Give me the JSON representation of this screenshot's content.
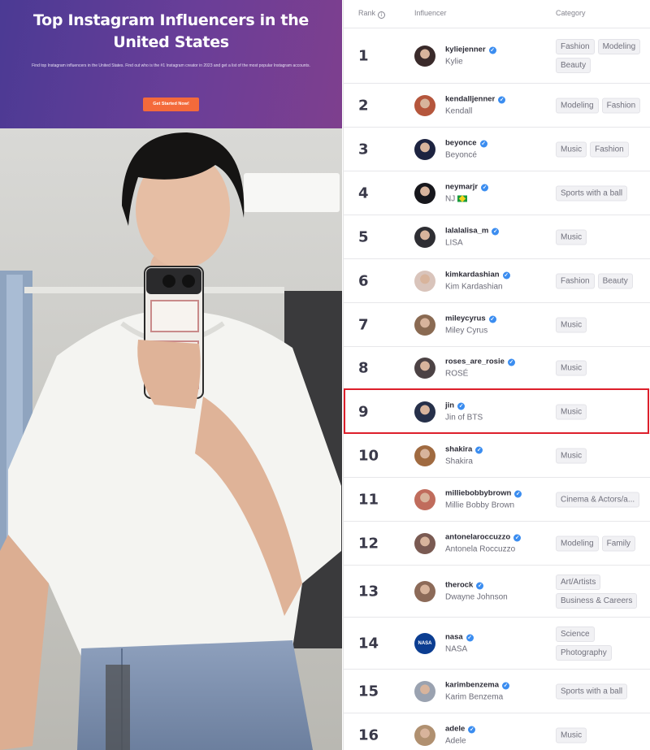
{
  "hero": {
    "title": "Top Instagram Influencers in the United States",
    "subtitle": "Find top Instagram influencers in the United States. Find out who is the #1 Instagram creator in 2023 and get a list of the most popular Instagram accounts.",
    "cta_label": "Get Started Now!"
  },
  "table": {
    "headers": {
      "rank": "Rank",
      "rank_info_icon": "info-icon",
      "influencer": "Influencer",
      "category": "Category"
    },
    "highlight_color": "#dd1f2b",
    "verified_color": "#3b8df0",
    "rows": [
      {
        "rank": "1",
        "handle": "kyliejenner",
        "name": "Kylie",
        "categories": [
          "Fashion",
          "Modeling",
          "Beauty"
        ],
        "avatar_color": "#3a2a2a"
      },
      {
        "rank": "2",
        "handle": "kendalljenner",
        "name": "Kendall",
        "categories": [
          "Modeling",
          "Fashion"
        ],
        "avatar_color": "#b5563c"
      },
      {
        "rank": "3",
        "handle": "beyonce",
        "name": "Beyoncé",
        "categories": [
          "Music",
          "Fashion"
        ],
        "avatar_color": "#1d2340"
      },
      {
        "rank": "4",
        "handle": "neymarjr",
        "name": "NJ",
        "categories": [
          "Sports with a ball"
        ],
        "avatar_color": "#17171c",
        "flag": "brazil-flag-icon"
      },
      {
        "rank": "5",
        "handle": "lalalalisa_m",
        "name": "LISA",
        "categories": [
          "Music"
        ],
        "avatar_color": "#2e2e33"
      },
      {
        "rank": "6",
        "handle": "kimkardashian",
        "name": "Kim Kardashian",
        "categories": [
          "Fashion",
          "Beauty"
        ],
        "avatar_color": "#d9c4bb"
      },
      {
        "rank": "7",
        "handle": "mileycyrus",
        "name": "Miley Cyrus",
        "categories": [
          "Music"
        ],
        "avatar_color": "#8a6a52"
      },
      {
        "rank": "8",
        "handle": "roses_are_rosie",
        "name": "ROSÉ",
        "categories": [
          "Music"
        ],
        "avatar_color": "#4c4244"
      },
      {
        "rank": "9",
        "handle": "jin",
        "name": "Jin of BTS",
        "categories": [
          "Music"
        ],
        "avatar_color": "#26304a"
      },
      {
        "rank": "10",
        "handle": "shakira",
        "name": "Shakira",
        "categories": [
          "Music"
        ],
        "avatar_color": "#a06a40"
      },
      {
        "rank": "11",
        "handle": "milliebobbybrown",
        "name": "Millie Bobby Brown",
        "categories": [
          "Cinema & Actors/a..."
        ],
        "avatar_color": "#c06c5c"
      },
      {
        "rank": "12",
        "handle": "antonelaroccuzzo",
        "name": "Antonela Roccuzzo",
        "categories": [
          "Modeling",
          "Family"
        ],
        "avatar_color": "#7a5a52"
      },
      {
        "rank": "13",
        "handle": "therock",
        "name": "Dwayne Johnson",
        "categories": [
          "Art/Artists",
          "Business & Careers"
        ],
        "avatar_color": "#8c6a58"
      },
      {
        "rank": "14",
        "handle": "nasa",
        "name": "NASA",
        "categories": [
          "Science",
          "Photography"
        ],
        "avatar_color": "#0b3d91",
        "avatar_text": "NASA"
      },
      {
        "rank": "15",
        "handle": "karimbenzema",
        "name": "Karim Benzema",
        "categories": [
          "Sports with a ball"
        ],
        "avatar_color": "#9aa2b0"
      },
      {
        "rank": "16",
        "handle": "adele",
        "name": "Adele",
        "categories": [
          "Music"
        ],
        "avatar_color": "#b09070"
      }
    ]
  }
}
